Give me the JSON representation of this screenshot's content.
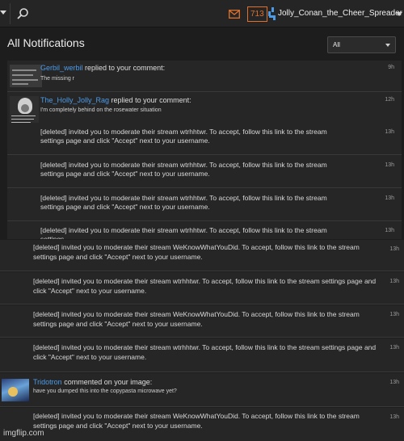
{
  "topbar": {
    "notification_count": "713",
    "username": "Jolly_Conan_the_Cheer_Spreader"
  },
  "header": {
    "title": "All Notifications",
    "filter_value": "All"
  },
  "notifications": [
    {
      "user": "Gerbil_werbil",
      "action": " replied to your comment:",
      "snippet": "The missing r",
      "time": "9h"
    },
    {
      "user": "The_Holly_Jolly_Rag",
      "action": " replied to your comment:",
      "snippet": "I'm completely behind on the rosewater situation",
      "time": "12h"
    },
    {
      "text": "[deleted] invited you to moderate their stream wtrhhtwr. To accept, follow this link to the stream settings page and click \"Accept\" next to your username.",
      "time": "13h"
    },
    {
      "text": "[deleted] invited you to moderate their stream wtrhhtwr. To accept, follow this link to the stream settings page and click \"Accept\" next to your username.",
      "time": "13h"
    },
    {
      "text": "[deleted] invited you to moderate their stream wtrhhtwr. To accept, follow this link to the stream settings page and click \"Accept\" next to your username.",
      "time": "13h"
    },
    {
      "text": "[deleted] invited you to moderate their stream wtrhhtwr. To accept, follow this link to the stream settings",
      "time": "13h"
    }
  ],
  "rows": [
    {
      "text": "[deleted] invited you to moderate their stream WeKnowWhatYouDid. To accept, follow this link to the stream settings page and click \"Accept\" next to your username.",
      "time": "13h"
    },
    {
      "text": "[deleted] invited you to moderate their stream wtrhhtwr. To accept, follow this link to the stream settings page and click \"Accept\" next to your username.",
      "time": "13h"
    },
    {
      "text": "[deleted] invited you to moderate their stream WeKnowWhatYouDid. To accept, follow this link to the stream settings page and click \"Accept\" next to your username.",
      "time": "13h"
    },
    {
      "text": "[deleted] invited you to moderate their stream wtrhhtwr. To accept, follow this link to the stream settings page and click \"Accept\" next to your username.",
      "time": "13h"
    },
    {
      "user": "Tridotron",
      "action": " commented on your image:",
      "snippet": "have you dumped this into the copypasta microwave yet?",
      "time": "13h"
    },
    {
      "text": "[deleted] invited you to moderate their stream WeKnowWhatYouDid. To accept, follow this link to the stream settings page and click \"Accept\" next to your username.",
      "time": "13h"
    }
  ],
  "watermark": "imgflip.com",
  "colors": {
    "accent_orange": "#e0712c",
    "link_blue": "#4c9be8",
    "background": "#1d1d1d"
  }
}
